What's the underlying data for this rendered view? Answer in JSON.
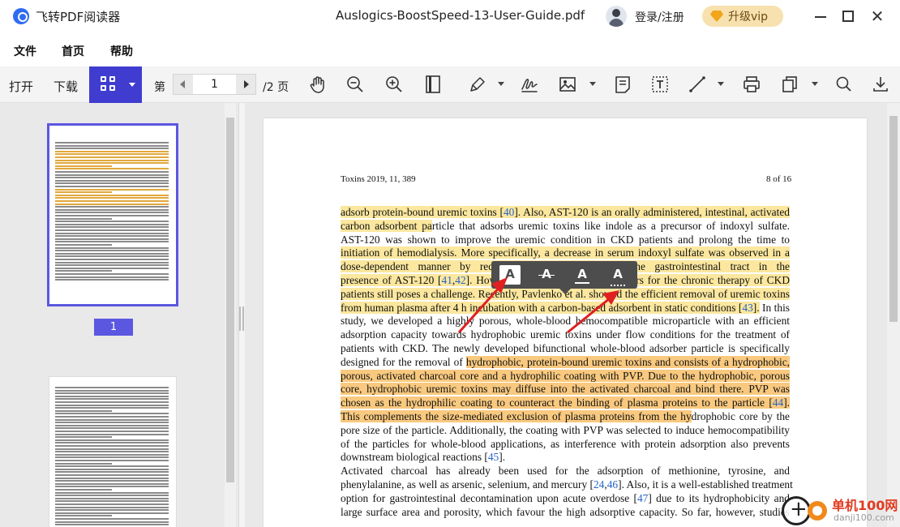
{
  "app": {
    "name": "飞转PDF阅读器",
    "document_title": "Auslogics-BoostSpeed-13-User-Guide.pdf",
    "login_label": "登录/注册",
    "vip_label": "升级vip",
    "brand_color": "#2f6bf3"
  },
  "menu": {
    "items": [
      {
        "label": "文件"
      },
      {
        "label": "首页"
      },
      {
        "label": "帮助"
      }
    ]
  },
  "toolbar": {
    "open_label": "打开",
    "download_label": "下载",
    "page_prefix": "第",
    "current_page": "1",
    "page_total": "/2 页",
    "accent_color": "#3f3ccf",
    "icons": [
      "hand-icon",
      "zoom-out-icon",
      "zoom-in-icon",
      "single-page-icon",
      "pen-icon",
      "signature-icon",
      "image-icon",
      "note-icon",
      "text-box-icon",
      "line-icon",
      "print-icon",
      "copy-icon",
      "search-icon",
      "download-icon"
    ]
  },
  "sidebar": {
    "page_badge": "1"
  },
  "page": {
    "header_left": "Toxins 2019, 11, 389",
    "header_right": "8 of 16",
    "lines": [
      {
        "segs": [
          {
            "t": "adsorb protein-bound uremic toxins [",
            "h": "y"
          },
          {
            "t": "40",
            "h": "y",
            "r": true
          },
          {
            "t": "]. Also, AST-120 is an orally administered, intestinal, activated",
            "h": "y"
          }
        ]
      },
      {
        "segs": [
          {
            "t": "carbon adsorbent pa",
            "h": "y"
          },
          {
            "t": "rticle that adsorbs uremic toxins like indole as a precursor of indoxyl sulfate."
          }
        ]
      },
      {
        "segs": [
          {
            "t": "AST-120 was shown to improve the uremic condition in CKD patients and prolong the time to"
          }
        ]
      },
      {
        "segs": [
          {
            "t": "initiation of hemodialysis.  More specifically, a decrease in serum indoxyl sulfate was observed in a",
            "h": "y"
          }
        ]
      },
      {
        "segs": [
          {
            "t": "dose-dependent manner by reducing its absorption from the gastrointestinal tract in the",
            "h": "y"
          }
        ]
      },
      {
        "segs": [
          {
            "t": "presence of AST-120 [",
            "h": "y"
          },
          {
            "t": "41",
            "h": "y",
            "r": true
          },
          {
            "t": ",",
            "h": "y"
          },
          {
            "t": "42",
            "h": "y",
            "r": true
          },
          {
            "t": "]. However, there is a lack of absorbers for the chronic therapy of CKD",
            "h": "y"
          }
        ]
      },
      {
        "segs": [
          {
            "t": "patients still poses a challenge.  Recently, Pavlenko et al. showed the efficient removal of uremic toxins",
            "h": "y"
          }
        ]
      },
      {
        "segs": [
          {
            "t": "from human plasma after 4 h incubation with a carbon-based adsorbent in static conditions [",
            "h": "y"
          },
          {
            "t": "43",
            "h": "y",
            "r": true
          },
          {
            "t": "].",
            "h": "y"
          },
          {
            "t": " In this"
          }
        ]
      },
      {
        "segs": [
          {
            "t": "study, we developed a highly porous, whole-blood hemocompatible microparticle with an efficient"
          }
        ]
      },
      {
        "segs": [
          {
            "t": "adsorption capacity towards hydrophobic uremic toxins under flow conditions for the treatment of"
          }
        ]
      },
      {
        "segs": [
          {
            "t": "patients with CKD. The newly developed bifunctional whole-blood adsorber particle is specifically"
          }
        ]
      },
      {
        "segs": [
          {
            "t": "designed for the removal of "
          },
          {
            "t": "hydrophobic, protein-bound uremic toxins and consists of a hydrophobic,",
            "h": "o"
          }
        ]
      },
      {
        "segs": [
          {
            "t": "porous, activated charcoal core and a hydrophilic coating with PVP. Due to the hydrophobic, porous",
            "h": "o"
          }
        ]
      },
      {
        "segs": [
          {
            "t": "core, hydrophobic uremic toxins may diffuse into the activated charcoal and bind there.  PVP was",
            "h": "o"
          }
        ]
      },
      {
        "segs": [
          {
            "t": "chosen as the hydrophilic coating to counteract the binding of plasma proteins to the particle [",
            "h": "o"
          },
          {
            "t": "44",
            "h": "o",
            "r": true
          },
          {
            "t": "].",
            "h": "o"
          }
        ]
      },
      {
        "segs": [
          {
            "t": "This complements the size-mediated exclusion of plasma proteins from the hy",
            "h": "o"
          },
          {
            "t": "drophobic core by the"
          }
        ]
      },
      {
        "segs": [
          {
            "t": "pore size of the particle.  Additionally, the coating with PVP was selected to induce hemocompatibility"
          }
        ]
      },
      {
        "segs": [
          {
            "t": "of the particles for whole-blood applications, as interference with protein adsorption also prevents"
          }
        ]
      },
      {
        "segs": [
          {
            "t": "downstream biological reactions ["
          },
          {
            "t": "45",
            "r": true
          },
          {
            "t": "]."
          }
        ],
        "last": true
      },
      {
        "segs": [
          {
            "t": "      Activated charcoal has already been used for the adsorption of methionine, tyrosine, and"
          }
        ]
      },
      {
        "segs": [
          {
            "t": "phenylalanine, as well as arsenic, selenium, and mercury ["
          },
          {
            "t": "24",
            "r": true
          },
          {
            "t": ","
          },
          {
            "t": "46",
            "r": true
          },
          {
            "t": "]. Also, it is a well-established treatment"
          }
        ]
      },
      {
        "segs": [
          {
            "t": "option for gastrointestinal decontamination upon acute overdose ["
          },
          {
            "t": "47",
            "r": true
          },
          {
            "t": "] due to its hydrophobicity and"
          }
        ]
      },
      {
        "segs": [
          {
            "t": "large surface area and porosity, which favour the high adsorptive capacity. So far, however, studies"
          }
        ]
      }
    ]
  },
  "markup_toolbar": {
    "highlight_glyph": "A",
    "strikethrough_glyph": "A",
    "underline_glyph": "A",
    "squiggly_glyph": "A",
    "arrow_color": "#e02020"
  },
  "watermark": {
    "name": "单机100网",
    "url": "danji100.com"
  }
}
